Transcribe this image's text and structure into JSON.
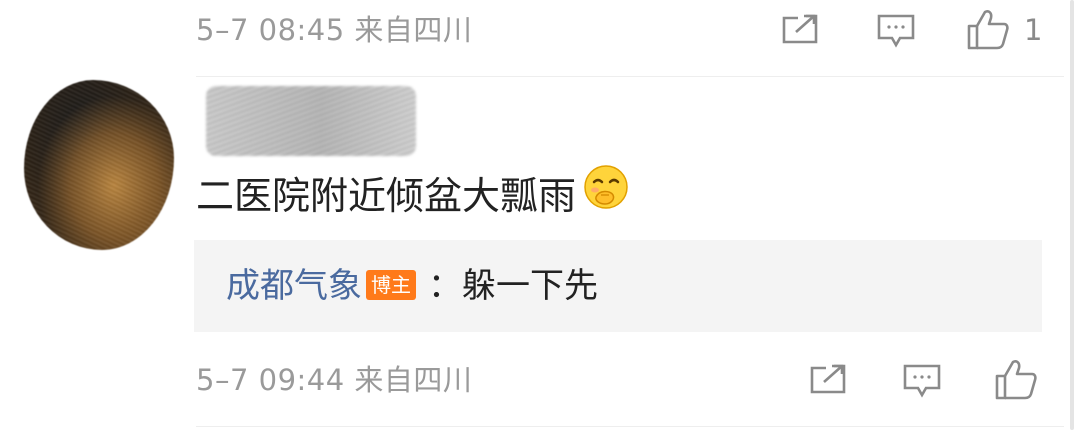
{
  "comment_top": {
    "time_location": "5–7 08:45  来自四川",
    "like_count": "1"
  },
  "comment": {
    "text": "二医院附近倾盆大瓢雨",
    "emoji_icon": "laughing-covering-mouth-emoji",
    "reply": {
      "user": "成都气象",
      "badge": "博主",
      "text": "：躲一下先"
    },
    "time_location": "5–7 09:44  来自四川"
  },
  "icons": {
    "share": "share-icon",
    "comment": "comment-icon",
    "like": "thumbs-up-icon"
  },
  "colors": {
    "reply_user": "#4a6a9f",
    "badge": "#ff7a1a",
    "meta_text": "#9a9a9a"
  }
}
